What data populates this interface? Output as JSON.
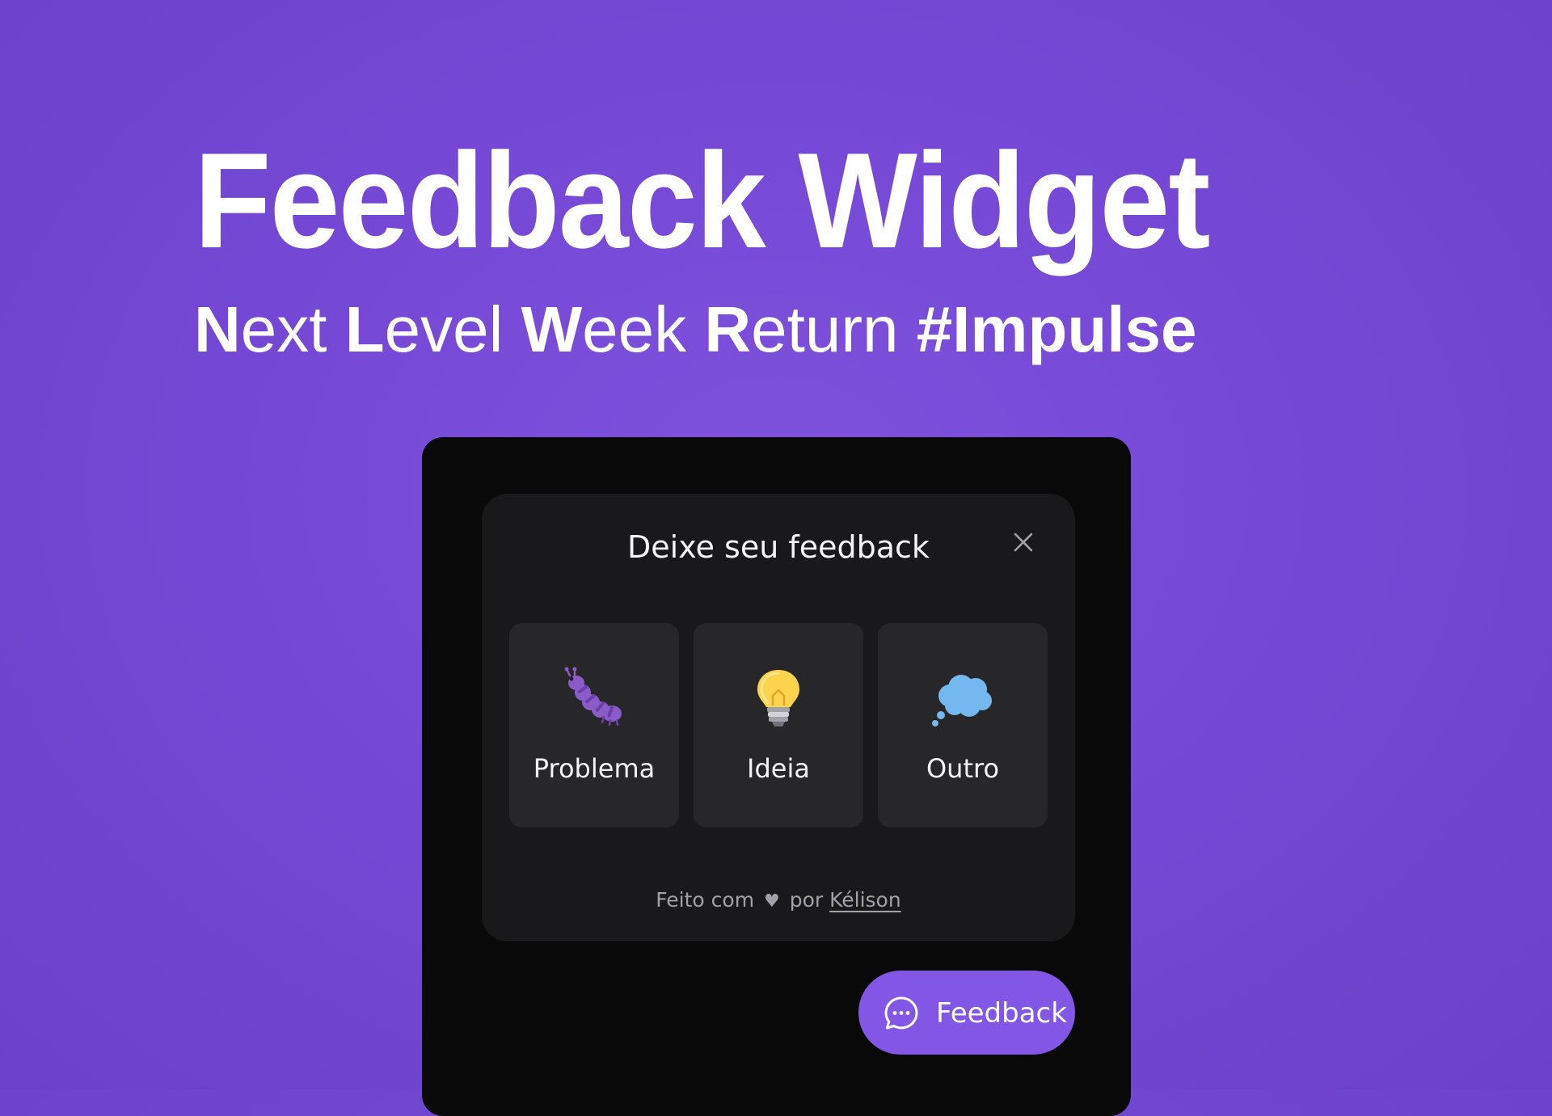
{
  "hero": {
    "title": "Feedback Widget",
    "subtitle_parts": {
      "p1b": "N",
      "p1": "ext ",
      "p2b": "L",
      "p2": "evel ",
      "p3b": "W",
      "p3": "eek ",
      "p4b": "R",
      "p4": "eturn ",
      "p5b": "#Impulse"
    }
  },
  "widget": {
    "title": "Deixe seu feedback",
    "close_icon": "close-icon",
    "options": [
      {
        "label": "Problema",
        "icon": "bug-icon"
      },
      {
        "label": "Ideia",
        "icon": "lightbulb-icon"
      },
      {
        "label": "Outro",
        "icon": "thought-bubble-icon"
      }
    ],
    "footer": {
      "prefix": "Feito com",
      "heart": "♥",
      "middle": "por",
      "author": "Kélison"
    }
  },
  "launcher": {
    "label": "Feedback",
    "icon": "chat-bubble-icon"
  },
  "colors": {
    "background": "#7549d6",
    "brand": "#8257e5",
    "frame": "#09090a",
    "card": "#19191b",
    "option": "#27272a"
  }
}
